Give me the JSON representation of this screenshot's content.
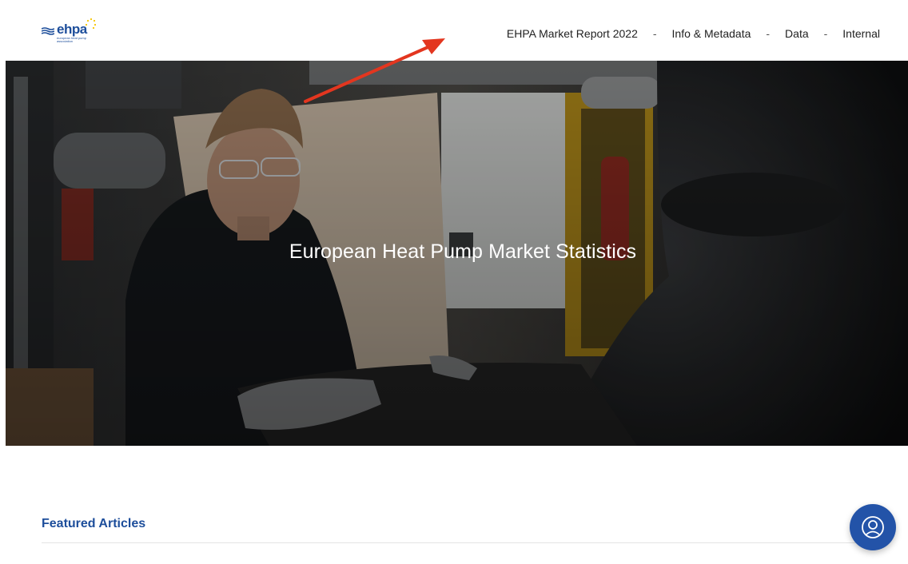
{
  "header": {
    "logo": {
      "brand": "ehpa",
      "subtitle": "european heat pump association"
    },
    "nav": [
      {
        "label": "EHPA Market Report 2022"
      },
      {
        "label": "Info & Metadata"
      },
      {
        "label": "Data"
      },
      {
        "label": "Internal"
      }
    ],
    "separator": "-"
  },
  "hero": {
    "title": "European Heat Pump Market Statistics"
  },
  "featured": {
    "heading": "Featured Articles"
  },
  "chat": {
    "icon": "user-circle-icon"
  },
  "colors": {
    "brand_blue": "#1d4e9b",
    "fab_blue": "#2353a8",
    "annotation_red": "#e3361f",
    "logo_yellow": "#f5c400"
  }
}
